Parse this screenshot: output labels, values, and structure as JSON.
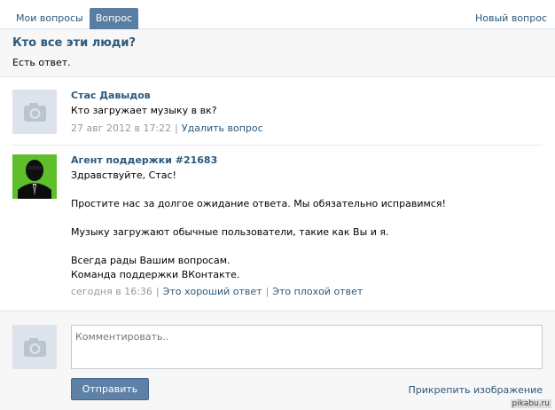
{
  "tabs": {
    "my_questions": "Мои вопросы",
    "question": "Вопрос",
    "new_question": "Новый вопрос"
  },
  "question": {
    "title": "Кто все эти люди?",
    "status": "Есть ответ."
  },
  "user_message": {
    "author": "Стас Давыдов",
    "text": "Кто загружает музыку в вк?",
    "date": "27 авг 2012 в 17:22",
    "delete_link": "Удалить вопрос"
  },
  "agent_message": {
    "author": "Агент поддержки #21683",
    "lines": [
      "Здравствуйте, Стас!",
      "Простите нас за долгое ожидание ответа. Мы обязательно исправимся!",
      "Музыку загружают обычные пользователи, такие как Вы и я.",
      "Всегда рады Вашим вопросам.",
      "Команда поддержки ВКонтакте."
    ],
    "date": "сегодня в 16:36",
    "good_link": "Это хороший ответ",
    "bad_link": "Это плохой ответ"
  },
  "reply": {
    "placeholder": "Комментировать..",
    "send_label": "Отправить",
    "attach_label": "Прикрепить изображение"
  },
  "watermark": "pikabu.ru",
  "colors": {
    "accent": "#597da3",
    "link": "#2b587a",
    "agent_avatar_bg": "#5fbf2a"
  },
  "icons": {
    "avatar_placeholder": "camera-icon"
  }
}
